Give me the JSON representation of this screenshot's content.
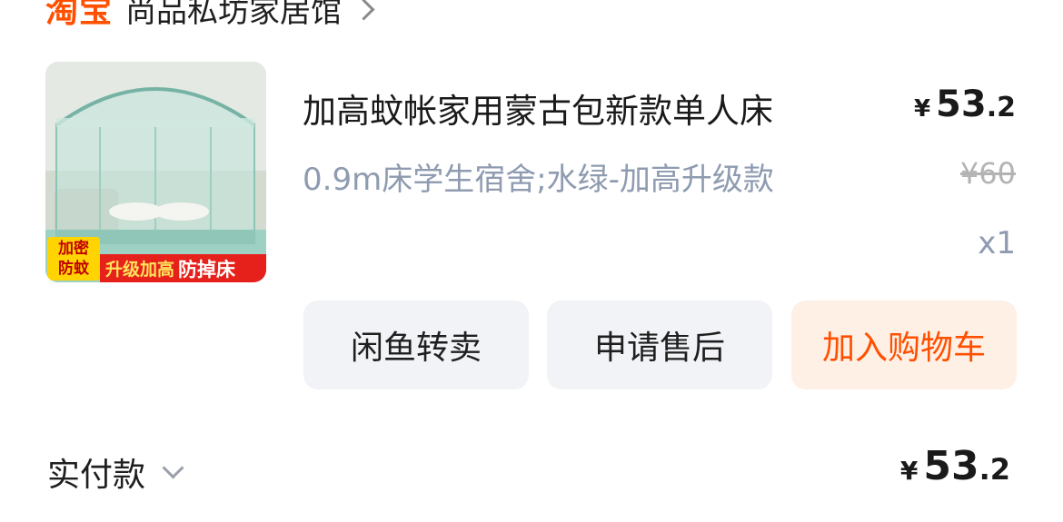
{
  "shop": {
    "logo_text": "淘宝",
    "name": "尚品私坊家居馆"
  },
  "product": {
    "title": "加高蚊帐家用蒙古包新款单人床",
    "spec": "0.9m床学生宿舍;水绿-加高升级款",
    "price": {
      "currency": "¥",
      "integer": "53",
      "decimal": ".2"
    },
    "original_price": "¥60",
    "quantity": "x1",
    "image_badges": {
      "left_line1": "加密",
      "left_line2": "防蚊",
      "right_part1": "升级加高",
      "right_part2": "防掉床"
    }
  },
  "actions": {
    "resell": "闲鱼转卖",
    "after_sales": "申请售后",
    "add_to_cart": "加入购物车"
  },
  "payment": {
    "label": "实付款",
    "amount": {
      "currency": "¥",
      "integer": "53",
      "decimal": ".2"
    }
  },
  "colors": {
    "brand_orange": "#ff5000",
    "spec_grey_blue": "#8e9bb0"
  }
}
